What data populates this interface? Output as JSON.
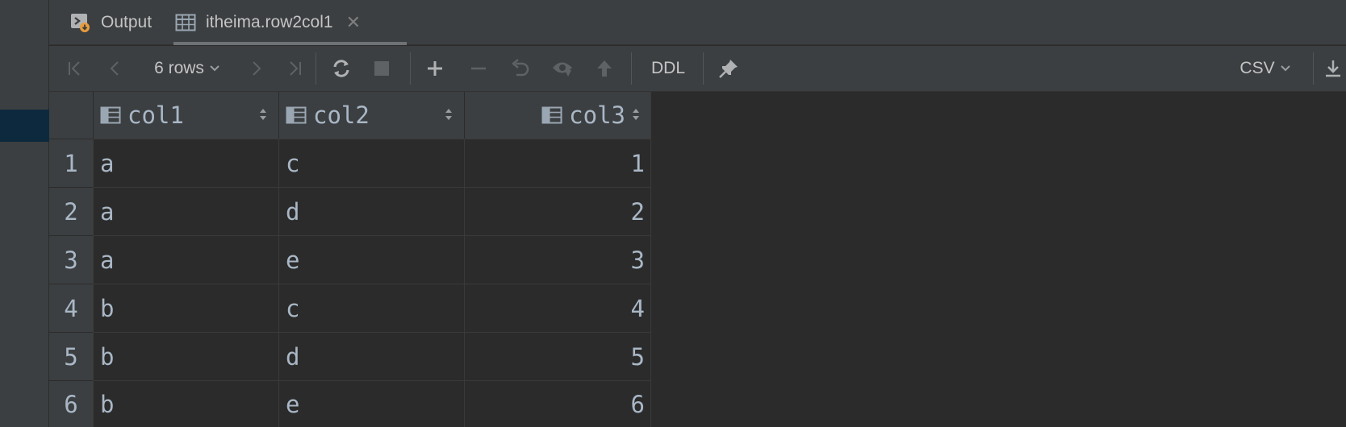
{
  "tabs": [
    {
      "label": "Output",
      "icon": "console-output-icon"
    },
    {
      "label": "itheima.row2col1",
      "icon": "table-icon",
      "active": true
    }
  ],
  "toolbar": {
    "rows_label": "6 rows",
    "ddl_label": "DDL",
    "format_label": "CSV"
  },
  "table": {
    "columns": [
      "col1",
      "col2",
      "col3"
    ],
    "rows": [
      {
        "num": "1",
        "col1": "a",
        "col2": "c",
        "col3": "1"
      },
      {
        "num": "2",
        "col1": "a",
        "col2": "d",
        "col3": "2"
      },
      {
        "num": "3",
        "col1": "a",
        "col2": "e",
        "col3": "3"
      },
      {
        "num": "4",
        "col1": "b",
        "col2": "c",
        "col3": "4"
      },
      {
        "num": "5",
        "col1": "b",
        "col2": "d",
        "col3": "5"
      },
      {
        "num": "6",
        "col1": "b",
        "col2": "e",
        "col3": "6"
      }
    ]
  },
  "colors": {
    "background": "#2b2b2b",
    "panel": "#3c3f41",
    "text": "#a9b7c6",
    "selection": "#0d293e",
    "icon_accent": "#e89c3b"
  }
}
